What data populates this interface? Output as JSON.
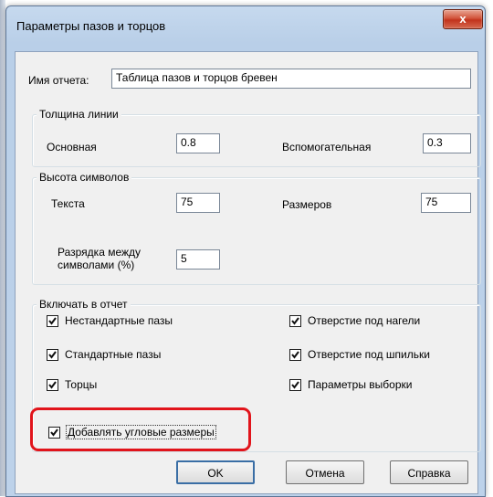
{
  "window": {
    "title": "Параметры пазов и торцов",
    "close_glyph": "x"
  },
  "report_name": {
    "label": "Имя отчета:",
    "value": "Таблица пазов и торцов бревен"
  },
  "line_thickness": {
    "legend": "Толщина линии",
    "main_label": "Основная",
    "main_value": "0.8",
    "aux_label": "Вспомогательная",
    "aux_value": "0.3"
  },
  "symbol_height": {
    "legend": "Высота символов",
    "text_label": "Текста",
    "text_value": "75",
    "sizes_label": "Размеров",
    "sizes_value": "75",
    "spacing_label_line1": "Разрядка между",
    "spacing_label_line2": "символами (%)",
    "spacing_value": "5"
  },
  "include": {
    "legend": "Включать в отчет",
    "items": [
      {
        "label": "Нестандартные пазы",
        "checked": true
      },
      {
        "label": "Отверстие под нагели",
        "checked": true
      },
      {
        "label": "Стандартные пазы",
        "checked": true
      },
      {
        "label": "Отверстие под шпильки",
        "checked": true
      },
      {
        "label": "Торцы",
        "checked": true
      },
      {
        "label": "Параметры выборки",
        "checked": true
      }
    ]
  },
  "angular": {
    "label": "Добавлять угловые размеры",
    "checked": true
  },
  "buttons": {
    "ok": "OK",
    "cancel": "Отмена",
    "help": "Справка"
  },
  "colors": {
    "highlight": "#e1141b",
    "close_button": "#c2331c"
  }
}
